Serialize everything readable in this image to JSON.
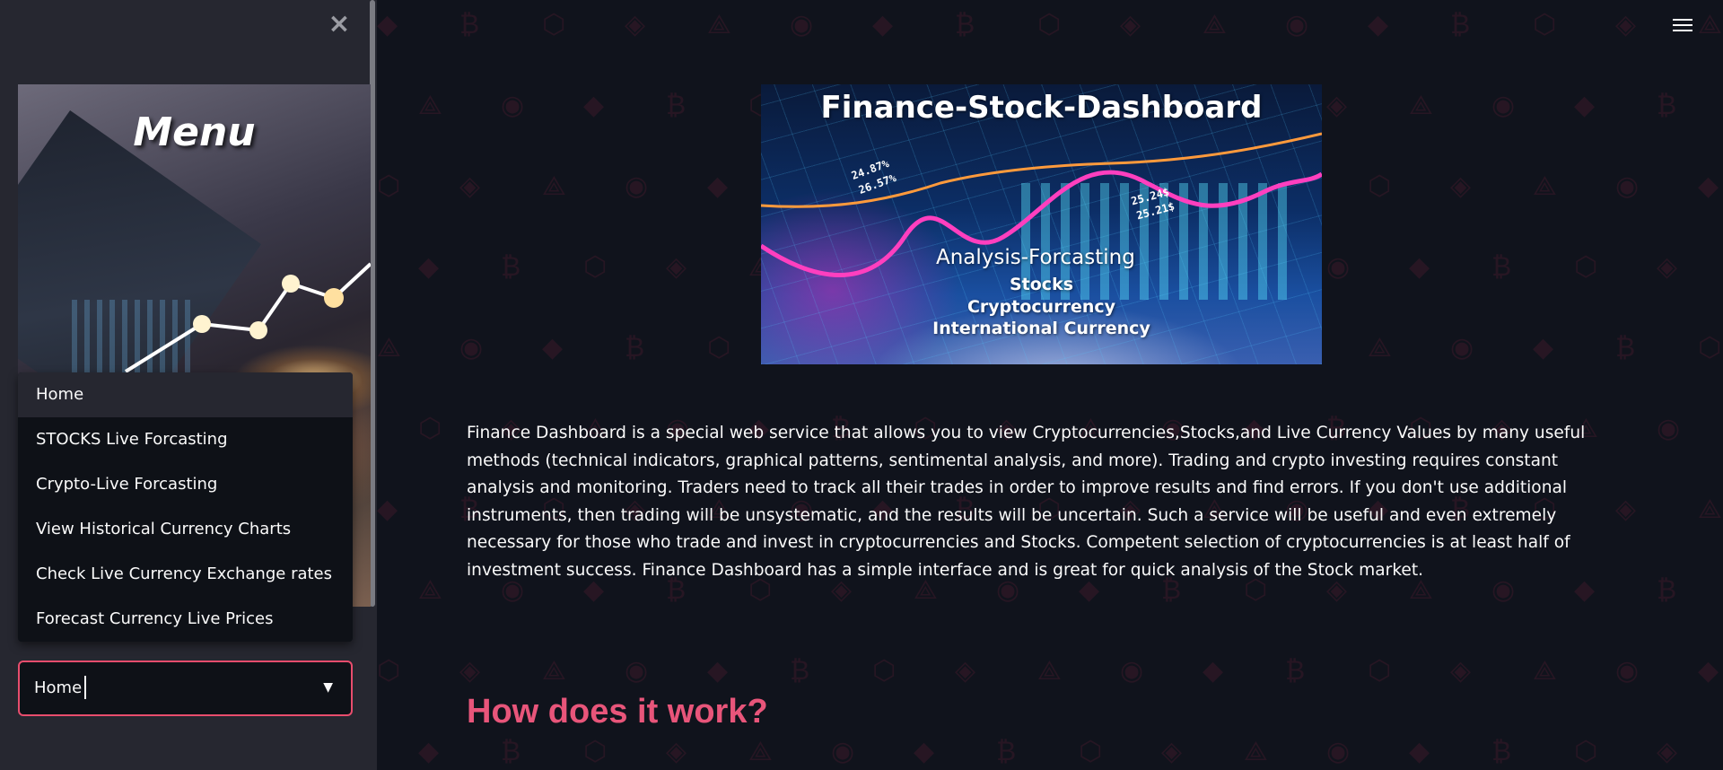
{
  "sidebar": {
    "close_label": "×",
    "menu_image_title": "Menu",
    "options": [
      "Home",
      "STOCKS Live Forcasting",
      "Crypto-Live Forcasting",
      "View Historical Currency Charts",
      "Check Live Currency Exchange rates",
      "Forecast Currency Live Prices"
    ],
    "selected": "Home",
    "select_arrow": "▼"
  },
  "header": {
    "menu_icon": "hamburger-icon"
  },
  "banner": {
    "title": "Finance-Stock-Dashboard",
    "subtitle": "Analysis-Forcasting",
    "lines": [
      "Stocks",
      "Cryptocurrency",
      "International Currency"
    ],
    "numbers": [
      "24.87%",
      "26.57%",
      "25.24$",
      "25.21$"
    ]
  },
  "main": {
    "description": "Finance Dashboard is a special web service that allows you to view Cryptocurrencies,Stocks,and Live Currency Values by many useful methods (technical indicators, graphical patterns, sentimental analysis, and more). Trading and crypto investing requires constant analysis and monitoring. Traders need to track all their trades in order to improve results and find errors. If you don't use additional instruments, then trading will be unsystematic, and the results will be uncertain. Such a service will be useful and even extremely necessary for those who trade and invest in cryptocurrencies and Stocks. Competent selection of cryptocurrencies is at least half of investment success. Finance Dashboard has a simple interface and is great for quick analysis of the Stock market.",
    "section_heading": "How does it work?"
  },
  "colors": {
    "background": "#10131c",
    "sidebar": "#262730",
    "accent": "#e8557a",
    "select_border": "#e84d6d"
  }
}
